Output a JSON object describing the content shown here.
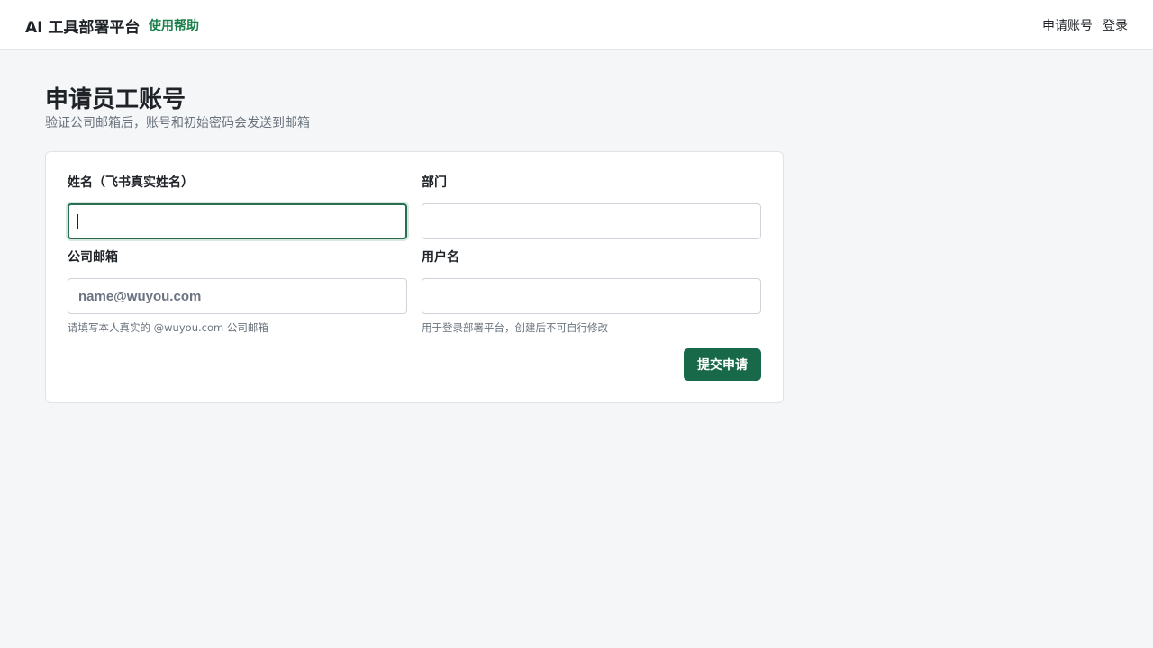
{
  "header": {
    "brand": "AI 工具部署平台",
    "help_link": "使用帮助",
    "nav": {
      "apply": "申请账号",
      "login": "登录"
    }
  },
  "page": {
    "title": "申请员工账号",
    "subtitle": "验证公司邮箱后，账号和初始密码会发送到邮箱"
  },
  "form": {
    "name": {
      "label": "姓名（飞书真实姓名）",
      "value": "",
      "placeholder": ""
    },
    "department": {
      "label": "部门",
      "value": "",
      "placeholder": ""
    },
    "email": {
      "label": "公司邮箱",
      "value": "",
      "placeholder": "name@wuyou.com",
      "hint": "请填写本人真实的 @wuyou.com 公司邮箱"
    },
    "username": {
      "label": "用户名",
      "value": "",
      "placeholder": "",
      "hint": "用于登录部署平台，创建后不可自行修改"
    },
    "submit_label": "提交申请"
  },
  "colors": {
    "accent": "#17694a",
    "help_link": "#1a7f4b",
    "background": "#f5f6f8"
  }
}
